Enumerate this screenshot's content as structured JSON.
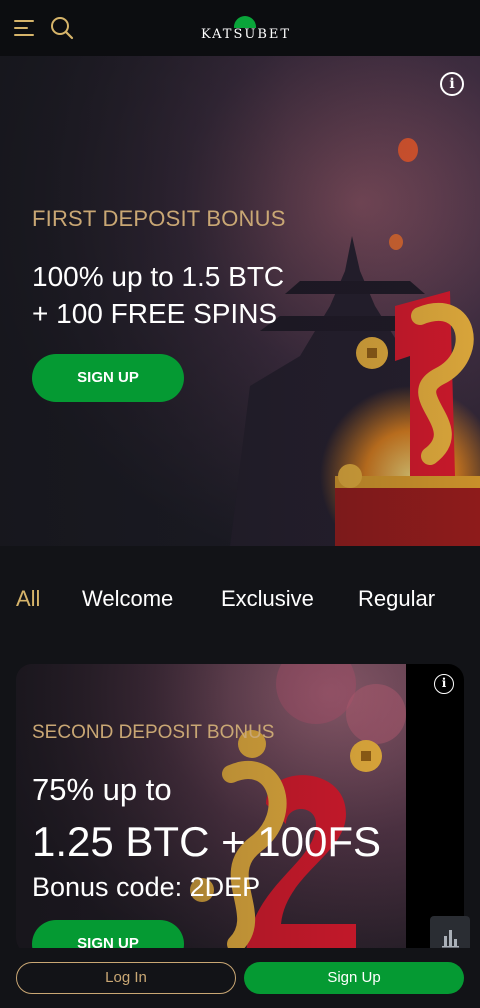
{
  "header": {
    "logo_text": "KATSUBET",
    "icons": {
      "menu": "hamburger-menu-icon",
      "search": "search-icon"
    },
    "accent_color": "#d6b46a"
  },
  "hero": {
    "info_symbol": "i",
    "kicker": "FIRST DEPOSIT BONUS",
    "title_line1": "100% up to 1.5 BTC",
    "title_line2": "+ 100 FREE SPINS",
    "button_label": "SIGN UP"
  },
  "tabs": [
    {
      "label": "All",
      "active": true
    },
    {
      "label": "Welcome",
      "active": false
    },
    {
      "label": "Exclusive",
      "active": false
    },
    {
      "label": "Regular",
      "active": false
    }
  ],
  "promo_card": {
    "info_symbol": "i",
    "kicker": "SECOND DEPOSIT BONUS",
    "line1": "75% up to",
    "line2": "1.25 BTC + 100FS",
    "line3": "Bonus code: 2DEP",
    "button_label": "SIGN UP"
  },
  "bottom_bar": {
    "login_label": "Log In",
    "signup_label": "Sign Up"
  },
  "colors": {
    "background": "#121317",
    "brand_green": "#059a33",
    "gold": "#c9a774"
  }
}
